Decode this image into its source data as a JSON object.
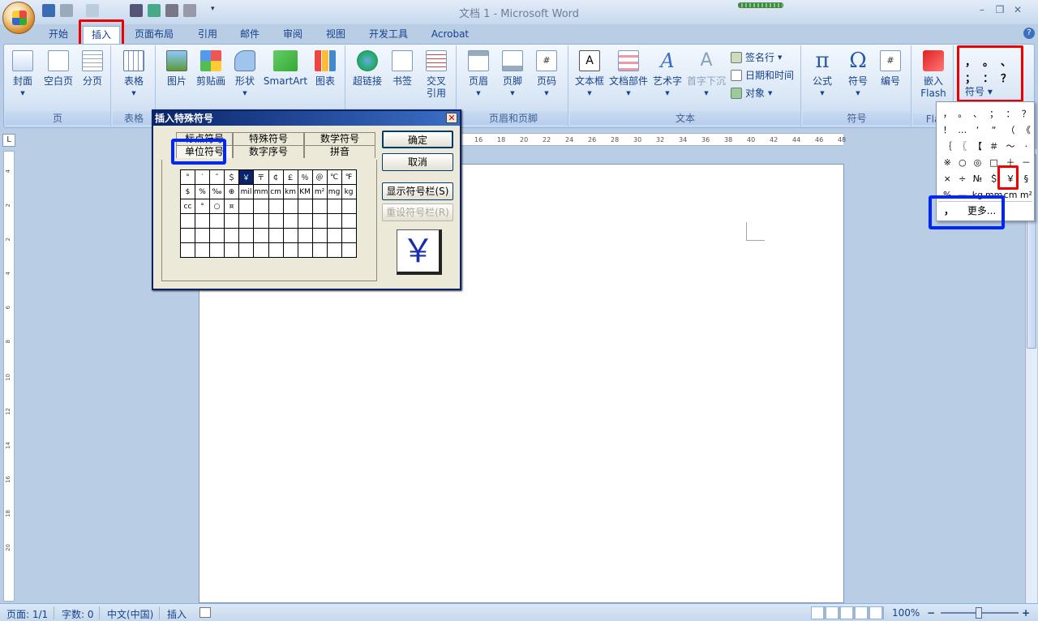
{
  "window": {
    "title": "文档 1 - Microsoft Word",
    "minimize": "–",
    "restore": "❐",
    "close": "✕"
  },
  "tabs": [
    "开始",
    "插入",
    "页面布局",
    "引用",
    "邮件",
    "审阅",
    "视图",
    "开发工具",
    "Acrobat"
  ],
  "active_tab": "插入",
  "ribbon": {
    "page_group": {
      "label": "页",
      "buttons": [
        "封面",
        "空白页",
        "分页"
      ]
    },
    "table_group": {
      "label": "表格",
      "buttons": [
        "表格"
      ]
    },
    "illustrations_group": {
      "label": "",
      "buttons": [
        "图片",
        "剪贴画",
        "形状",
        "SmartArt",
        "图表"
      ]
    },
    "links_group": {
      "buttons": [
        "超链接",
        "书签",
        "交叉",
        "引用"
      ]
    },
    "header_footer_group": {
      "label": "页眉和页脚",
      "buttons": [
        "页眉",
        "页脚",
        "页码"
      ]
    },
    "text_group": {
      "label": "文本",
      "buttons": [
        "文本框",
        "文档部件",
        "艺术字",
        "首字下沉"
      ],
      "small": [
        "签名行",
        "日期和时间",
        "对象"
      ]
    },
    "symbols_group": {
      "label": "符号",
      "buttons": [
        "公式",
        "符号",
        "编号"
      ]
    },
    "flash_group": {
      "label": "Fla",
      "buttons": [
        "嵌入",
        "Flash"
      ]
    },
    "special_group": {
      "symbols": [
        "，",
        "。",
        "、",
        "；",
        "：",
        "？"
      ],
      "label": "符号"
    }
  },
  "ruler": {
    "ticks": [
      "16",
      "18",
      "20",
      "22",
      "24",
      "26",
      "28",
      "30",
      "32",
      "34",
      "36",
      "38",
      "40",
      "42",
      "44",
      "46",
      "48"
    ]
  },
  "vruler": {
    "ticks": [
      "4",
      "2",
      "2",
      "4",
      "6",
      "8",
      "10",
      "12",
      "14",
      "16",
      "18",
      "20"
    ]
  },
  "dialog": {
    "title": "插入特殊符号",
    "close": "✕",
    "tabs_row1": [
      "标点符号",
      "特殊符号",
      "数学符号"
    ],
    "tabs_row2": [
      "单位符号",
      "数字序号",
      "拼音"
    ],
    "active_tab": "单位符号",
    "grid": [
      [
        "°",
        "′",
        "″",
        "＄",
        "￥",
        "〒",
        "￠",
        "￡",
        "％",
        "＠",
        "℃",
        "℉"
      ],
      [
        "$",
        "%",
        "‰",
        "⊕",
        "mil",
        "mm",
        "cm",
        "km",
        "KM",
        "m²",
        "mg",
        "kg"
      ],
      [
        "cc",
        "°",
        "○",
        "¤",
        "",
        "",
        "",
        "",
        "",
        "",
        "",
        ""
      ],
      [
        "",
        "",
        "",
        "",
        "",
        "",
        "",
        "",
        "",
        "",
        "",
        ""
      ],
      [
        "",
        "",
        "",
        "",
        "",
        "",
        "",
        "",
        "",
        "",
        "",
        ""
      ],
      [
        "",
        "",
        "",
        "",
        "",
        "",
        "",
        "",
        "",
        "",
        "",
        ""
      ]
    ],
    "selected": "￥",
    "buttons": {
      "ok": "确定",
      "cancel": "取消",
      "show_bar": "显示符号栏(S)",
      "reset_bar": "重设符号栏(R)"
    },
    "preview": "￥"
  },
  "symbol_dropdown": {
    "rows": [
      [
        "，",
        "。",
        "、",
        "；",
        "：",
        "？"
      ],
      [
        "！",
        "…",
        "‘",
        "“",
        "（",
        "《"
      ],
      [
        "｛",
        "〖",
        "【",
        "＃",
        "～",
        "·"
      ],
      [
        "※",
        "○",
        "◎",
        "□",
        "＋",
        "－"
      ],
      [
        "×",
        "÷",
        "№",
        "＄",
        "￥",
        "§"
      ],
      [
        "%",
        "—",
        "kg",
        "mm",
        "cm",
        "m²"
      ]
    ],
    "highlight": "￥",
    "more": "更多...",
    "more_icon": "，"
  },
  "status": {
    "page": "页面: 1/1",
    "words": "字数: 0",
    "language": "中文(中国)",
    "mode": "插入",
    "zoom": "100%",
    "zoom_minus": "−",
    "zoom_plus": "+"
  },
  "accent": "#15428b"
}
